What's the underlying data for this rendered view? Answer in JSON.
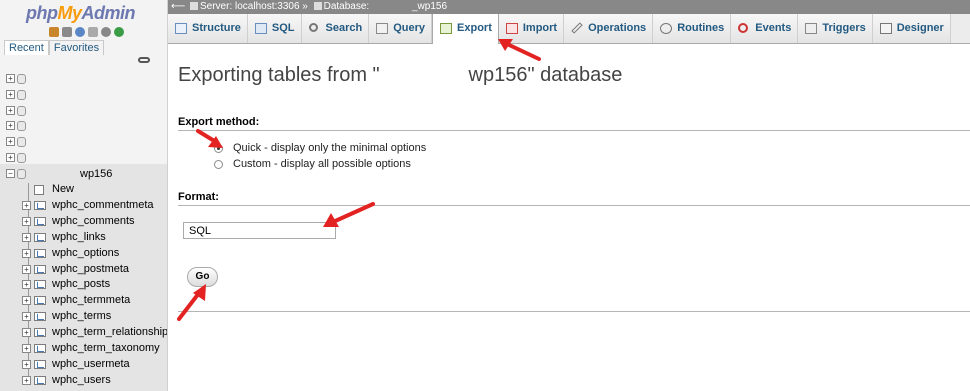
{
  "logo": {
    "php": "php",
    "my": "My",
    "admin": "Admin"
  },
  "nav": {
    "tabs": [
      "Recent",
      "Favorites"
    ],
    "active_db": "wp156",
    "tree_new": "New",
    "tables": [
      "wphc_commentmeta",
      "wphc_comments",
      "wphc_links",
      "wphc_options",
      "wphc_postmeta",
      "wphc_posts",
      "wphc_termmeta",
      "wphc_terms",
      "wphc_term_relationships",
      "wphc_term_taxonomy",
      "wphc_usermeta",
      "wphc_users"
    ]
  },
  "topbar": {
    "server": "Server: localhost:3306 »",
    "database_label": "Database:",
    "database_name": "_wp156"
  },
  "tabs": [
    "Structure",
    "SQL",
    "Search",
    "Query",
    "Export",
    "Import",
    "Operations",
    "Routines",
    "Events",
    "Triggers",
    "Designer"
  ],
  "active_tab": "Export",
  "main": {
    "title": "Exporting tables from \"                wp156\" database",
    "export_method_heading": "Export method:",
    "quick_option": "Quick - display only the minimal options",
    "custom_option": "Custom - display all possible options",
    "format_heading": "Format:",
    "format_value": "SQL",
    "go_label": "Go"
  },
  "colors": {
    "link": "#235a81",
    "annotation": "#e32222",
    "logo_orange": "#f89c0e",
    "logo_blue": "#6c78af"
  }
}
